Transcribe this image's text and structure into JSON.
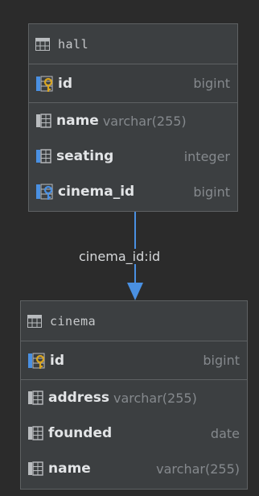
{
  "tables": {
    "hall": {
      "title": "hall",
      "pk": {
        "name": "id",
        "type": "bigint"
      },
      "columns": [
        {
          "name": "name",
          "type": "varchar(255)"
        },
        {
          "name": "seating",
          "type": "integer"
        },
        {
          "name": "cinema_id",
          "type": "bigint"
        }
      ]
    },
    "cinema": {
      "title": "cinema",
      "pk": {
        "name": "id",
        "type": "bigint"
      },
      "columns": [
        {
          "name": "address",
          "type": "varchar(255)"
        },
        {
          "name": "founded",
          "type": "date"
        },
        {
          "name": "name",
          "type": "varchar(255)"
        }
      ]
    }
  },
  "relation": {
    "label": "cinema_id:id",
    "from": "hall.cinema_id",
    "to": "cinema.id"
  },
  "colors": {
    "background": "#2b2b2b",
    "table_body": "#3c3f41",
    "border": "#5e6163",
    "connector": "#4a90e2",
    "key_gold": "#d9a520",
    "key_blue": "#4a90e2"
  },
  "icons": {
    "table": "table-icon",
    "primary_key": "primary-key-column-icon",
    "column": "column-icon",
    "foreign_key": "foreign-key-column-icon",
    "column_notnull": "column-notnull-icon"
  }
}
